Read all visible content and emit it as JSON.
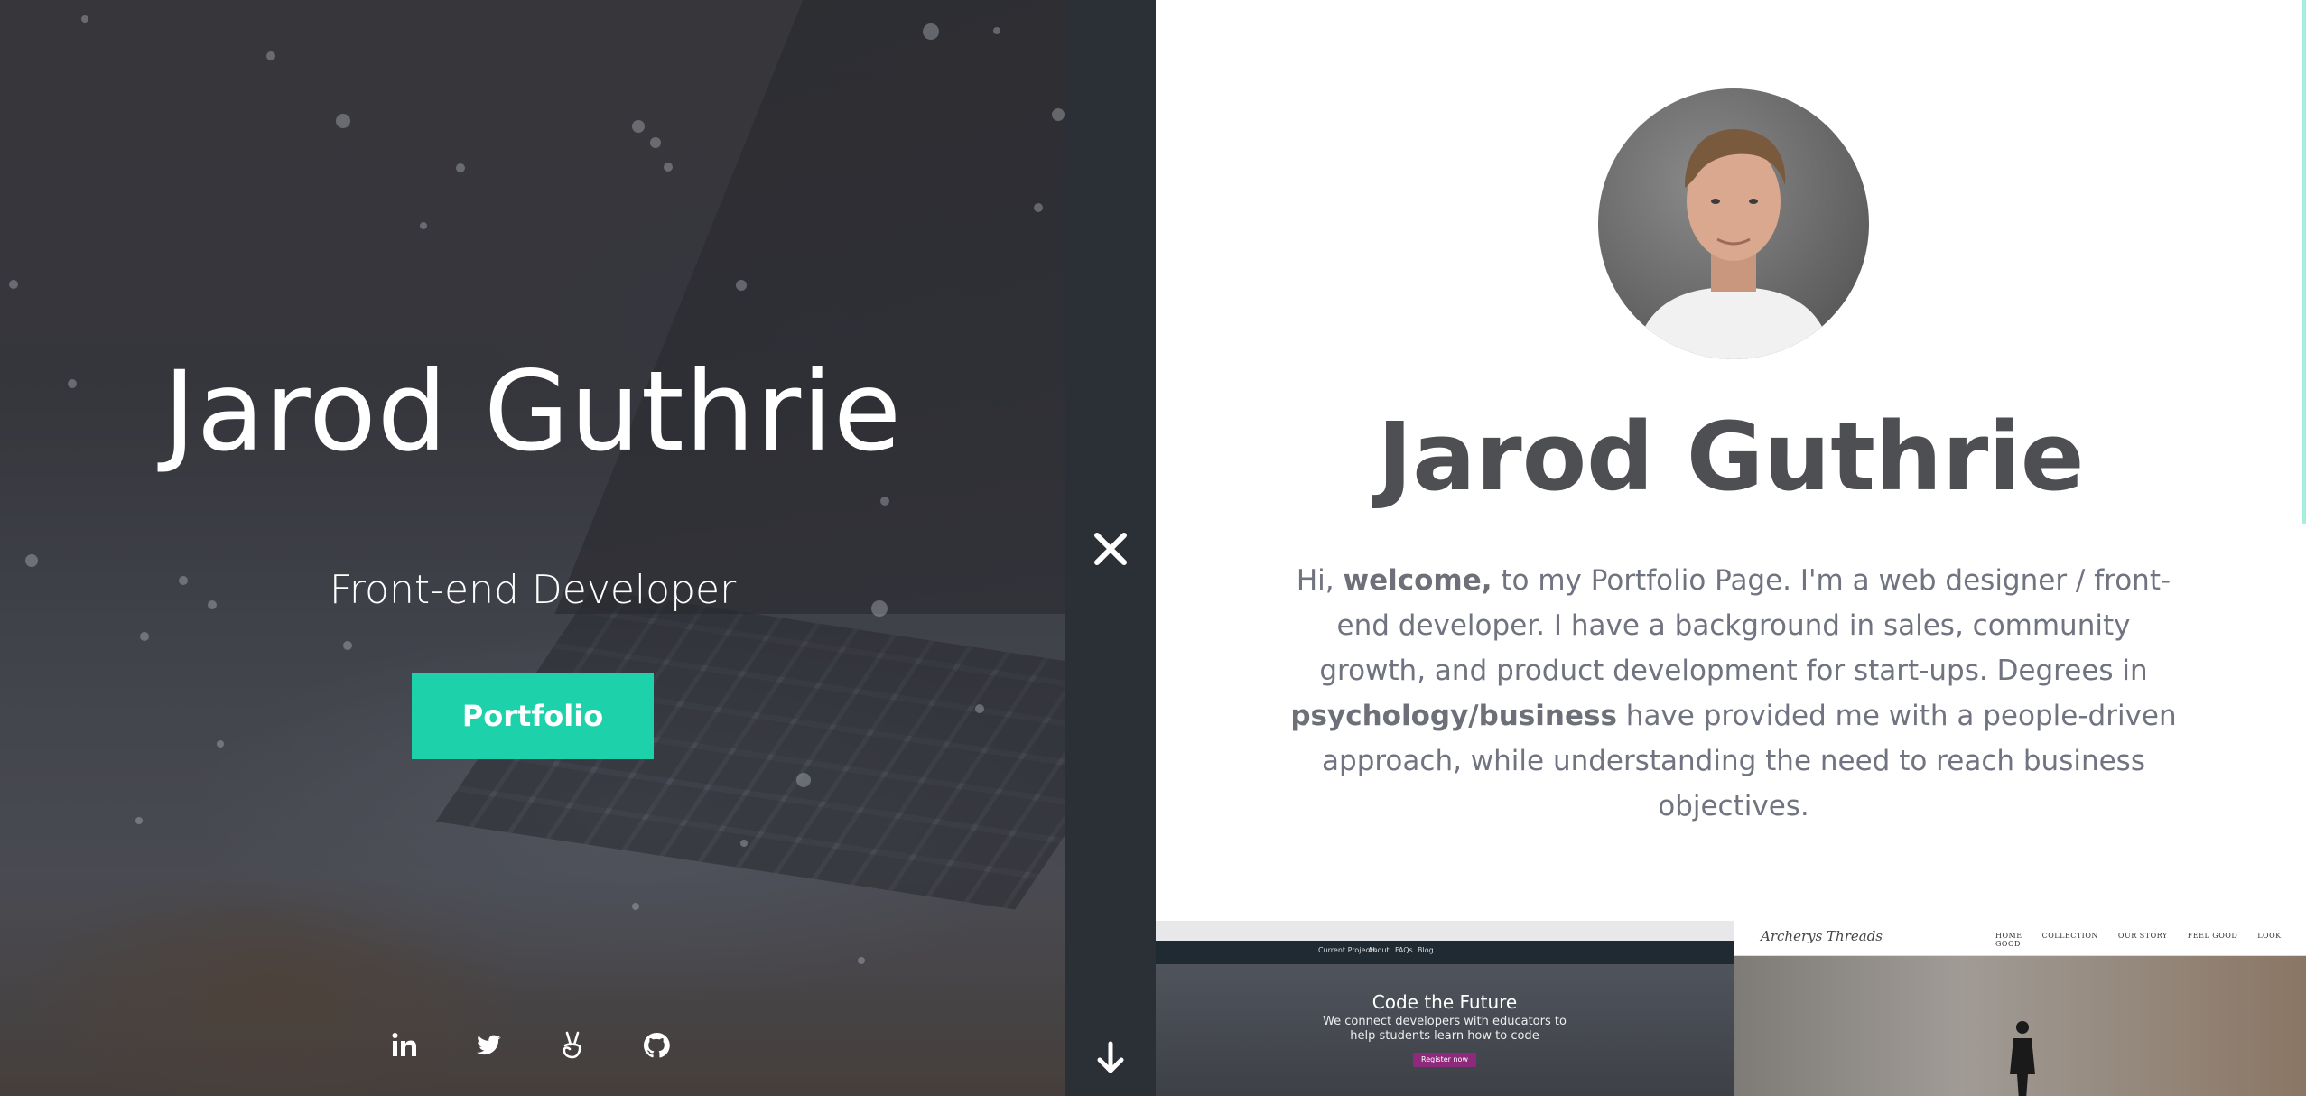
{
  "hero": {
    "name": "Jarod Guthrie",
    "subtitle": "Front-end Developer",
    "portfolio_label": "Portfolio",
    "social": [
      "linkedin-icon",
      "twitter-icon",
      "angellist-icon",
      "github-icon"
    ]
  },
  "nav": {
    "close_icon": "close-icon",
    "down_icon": "arrow-down-icon"
  },
  "about": {
    "name": "Jarod Guthrie",
    "bio": {
      "p1": "Hi, ",
      "b1": "welcome,",
      "p2": " to my Portfolio Page. I'm a web designer / front-end developer. I have a background in sales, community growth, and product development for start-ups. Degrees in ",
      "b2": "psychology/business",
      "p3": " have provided me with a people-driven approach, while understanding the need to reach business objectives."
    }
  },
  "projects": [
    {
      "title": "Code the Future",
      "subtitle": "We connect developers with educators to help students learn how to code",
      "button": "Register now",
      "nav": [
        "Current Projects",
        "About",
        "FAQs",
        "Blog"
      ]
    },
    {
      "logo": "Archerys Threads",
      "nav": [
        "HOME",
        "COLLECTION",
        "OUR STORY",
        "FEEL GOOD",
        "LOOK GOOD"
      ]
    }
  ],
  "colors": {
    "accent": "#1dd1aa",
    "strip": "#2b2f36",
    "title": "#4e4f53",
    "text": "#707380"
  }
}
